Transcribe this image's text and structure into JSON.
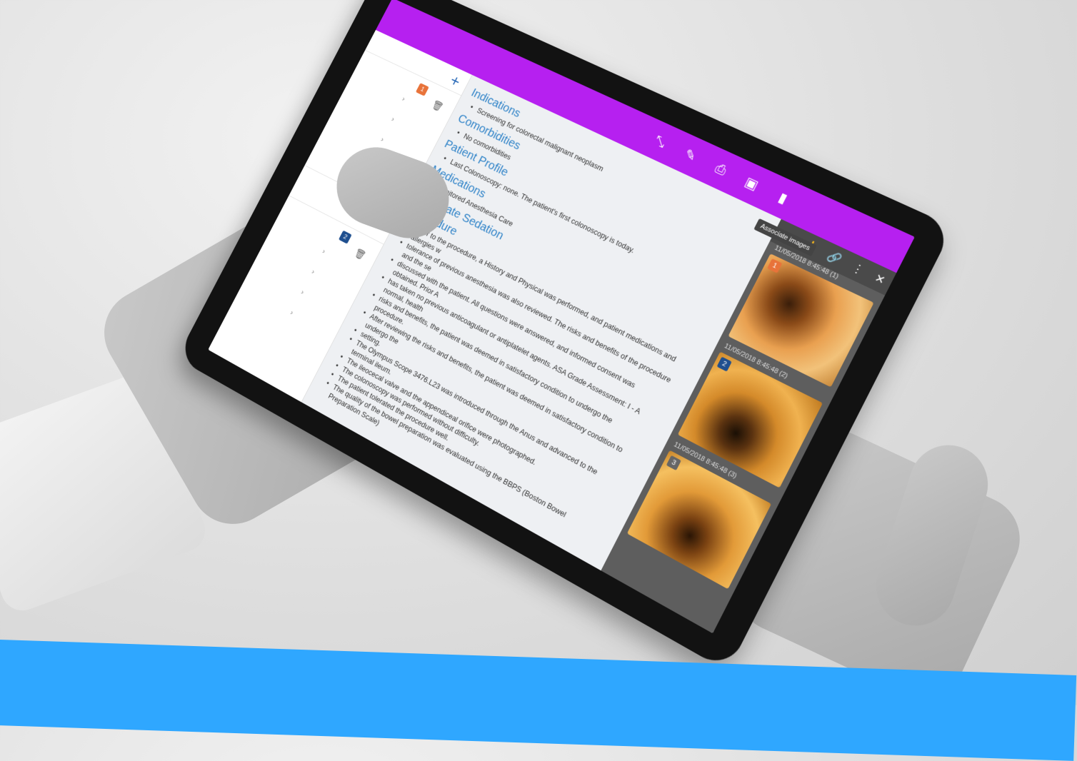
{
  "sidebar": {
    "add_icon": "plus-icon",
    "groups": [
      {
        "badge": "1",
        "badge_color": "#e8733a"
      },
      {
        "badge": "2",
        "badge_color": "#1f4f8f"
      }
    ]
  },
  "report": {
    "sections": [
      {
        "heading": "Indications",
        "items": [
          "Screening for colorectal malignant neoplasm"
        ]
      },
      {
        "heading": "Comorbidities",
        "items": [
          "No comorbidities"
        ]
      },
      {
        "heading": "Patient Profile",
        "items": [
          "Last Colonoscopy: none. The patient's first colonoscopy is today."
        ]
      },
      {
        "heading": "Medications",
        "items": [
          "Monitored Anesthesia Care"
        ]
      },
      {
        "heading": "Moderate Sedation",
        "items": []
      },
      {
        "heading": "Procedure",
        "items": [
          "Prior to the procedure, a History and Physical was performed, and patient medications and allergies w",
          "tolerance of previous anesthesia was also reviewed. The risks and benefits of the procedure and the se",
          "discussed with the patient. All questions were answered, and informed consent was obtained. Prior A",
          "has taken no previous anticoagulant or antiplatelet agents. ASA Grade Assessment: I - A normal, health",
          "risks and benefits, the patient was deemed in satisfactory condition to undergo the procedure.",
          "After reviewing the risks and benefits, the patient was deemed in satisfactory condition to undergo the",
          "setting.",
          "The Olympus Scope 3476.L23 was introduced through the Anus and advanced to the terminal ileum.",
          "The ileocecal valve and the appendiceal orifice were photographed.",
          "The colonoscopy was performed without difficulty.",
          "The patient tolerated the procedure well.",
          "The quality of the bowel preparation was evaluated using the BBPS (Boston Bowel Preparation Scale)"
        ]
      }
    ]
  },
  "panel": {
    "tooltip": "Associate images",
    "images": [
      {
        "badge": "1",
        "badge_color": "#e8733a",
        "label": "11/05/2018 8:45:48 (1)"
      },
      {
        "badge": "2",
        "badge_color": "#1f4f8f",
        "label": "11/05/2018 8:45:48 (2)"
      },
      {
        "badge": "3",
        "badge_color": "#666666",
        "label": "11/05/2018 8:45:48 (3)"
      }
    ]
  },
  "colors": {
    "topbar": "#b620f0",
    "band": "#2fa7ff",
    "heading": "#2f83c8"
  }
}
